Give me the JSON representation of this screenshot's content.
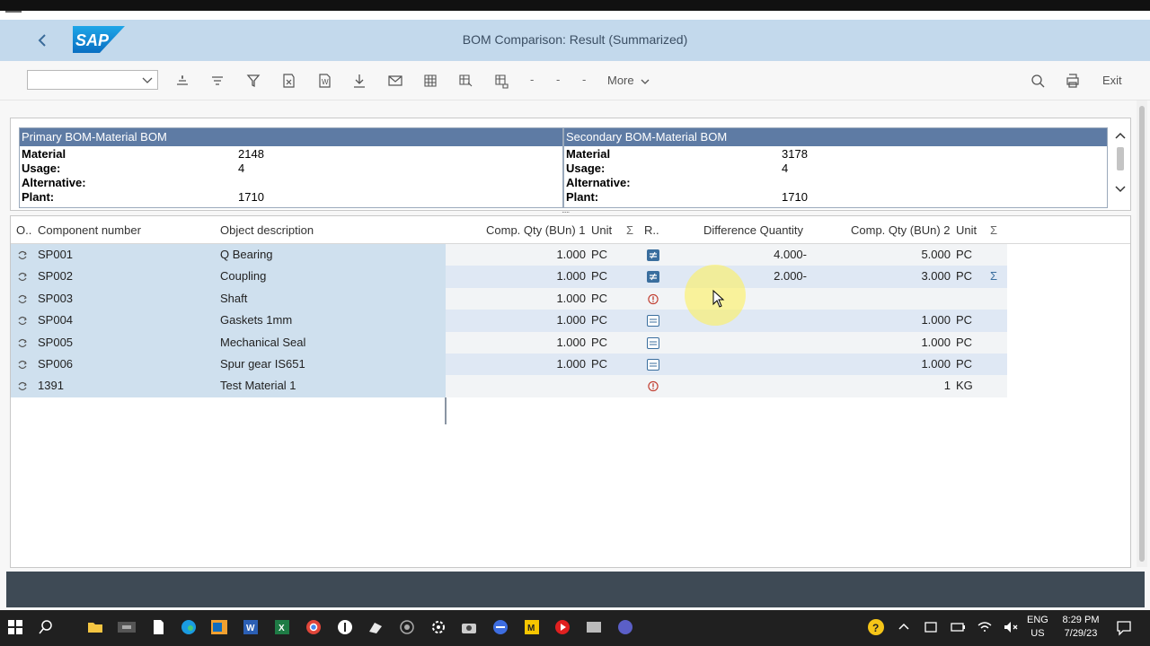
{
  "window": {
    "title": "BOM Comparison: Result (Summarized)",
    "logo": "SAP"
  },
  "toolbar": {
    "variant_value": "",
    "buttons": [
      "align-center-icon",
      "sort-icon",
      "filter-icon",
      "delete-filter-icon",
      "export-word-icon",
      "download-icon",
      "mail-icon",
      "grid-icon",
      "layout-icon",
      "layout-change-icon"
    ],
    "dashes": [
      "-",
      "-",
      "-"
    ],
    "more_label": "More",
    "exit_label": "Exit"
  },
  "primary": {
    "title": "Primary BOM-Material BOM",
    "rows": [
      {
        "label": "Material",
        "value": "2148"
      },
      {
        "label": "Usage:",
        "value": "4"
      },
      {
        "label": "Alternative:",
        "value": ""
      },
      {
        "label": "Plant:",
        "value": "1710"
      }
    ]
  },
  "secondary": {
    "title": "Secondary BOM-Material BOM",
    "rows": [
      {
        "label": "Material",
        "value": "3178"
      },
      {
        "label": "Usage:",
        "value": "4"
      },
      {
        "label": "Alternative:",
        "value": ""
      },
      {
        "label": "Plant:",
        "value": "1710"
      }
    ]
  },
  "grid": {
    "columns": {
      "o": "O..",
      "component": "Component number",
      "description": "Object description",
      "qty1": "Comp. Qty (BUn) 1",
      "unit1": "Unit",
      "sum1": "Σ",
      "r": "R..",
      "diff": "Difference Quantity",
      "qty2": "Comp. Qty (BUn) 2",
      "unit2": "Unit",
      "sum2": "Σ"
    },
    "rows": [
      {
        "component": "SP001",
        "description": "Q Bearing",
        "qty1": "1.000",
        "unit1": "PC",
        "r_icon": "difference-icon",
        "diff": "4.000-",
        "qty2": "5.000",
        "unit2": "PC",
        "sum2": ""
      },
      {
        "component": "SP002",
        "description": "Coupling",
        "qty1": "1.000",
        "unit1": "PC",
        "r_icon": "difference-icon",
        "diff": "2.000-",
        "qty2": "3.000",
        "unit2": "PC",
        "sum2": "Σ"
      },
      {
        "component": "SP003",
        "description": "Shaft",
        "qty1": "1.000",
        "unit1": "PC",
        "r_icon": "warning-icon",
        "diff": "",
        "qty2": "",
        "unit2": "",
        "sum2": ""
      },
      {
        "component": "SP004",
        "description": "Gaskets 1mm",
        "qty1": "1.000",
        "unit1": "PC",
        "r_icon": "equal-icon",
        "diff": "",
        "qty2": "1.000",
        "unit2": "PC",
        "sum2": ""
      },
      {
        "component": "SP005",
        "description": "Mechanical Seal",
        "qty1": "1.000",
        "unit1": "PC",
        "r_icon": "equal-icon",
        "diff": "",
        "qty2": "1.000",
        "unit2": "PC",
        "sum2": ""
      },
      {
        "component": "SP006",
        "description": "Spur gear IS651",
        "qty1": "1.000",
        "unit1": "PC",
        "r_icon": "equal-icon",
        "diff": "",
        "qty2": "1.000",
        "unit2": "PC",
        "sum2": ""
      },
      {
        "component": "1391",
        "description": "Test Material 1",
        "qty1": "",
        "unit1": "",
        "r_icon": "warning-icon",
        "diff": "",
        "qty2": "1",
        "unit2": "KG",
        "sum2": ""
      }
    ]
  },
  "taskbar": {
    "lang_line1": "ENG",
    "lang_line2": "US",
    "time": "8:29 PM",
    "date": "7/29/23"
  },
  "colors": {
    "shell": "#c3d9ec",
    "header_blue": "#5e7ba4",
    "row_left": "#cfe0ee",
    "status": "#3e4a55"
  }
}
